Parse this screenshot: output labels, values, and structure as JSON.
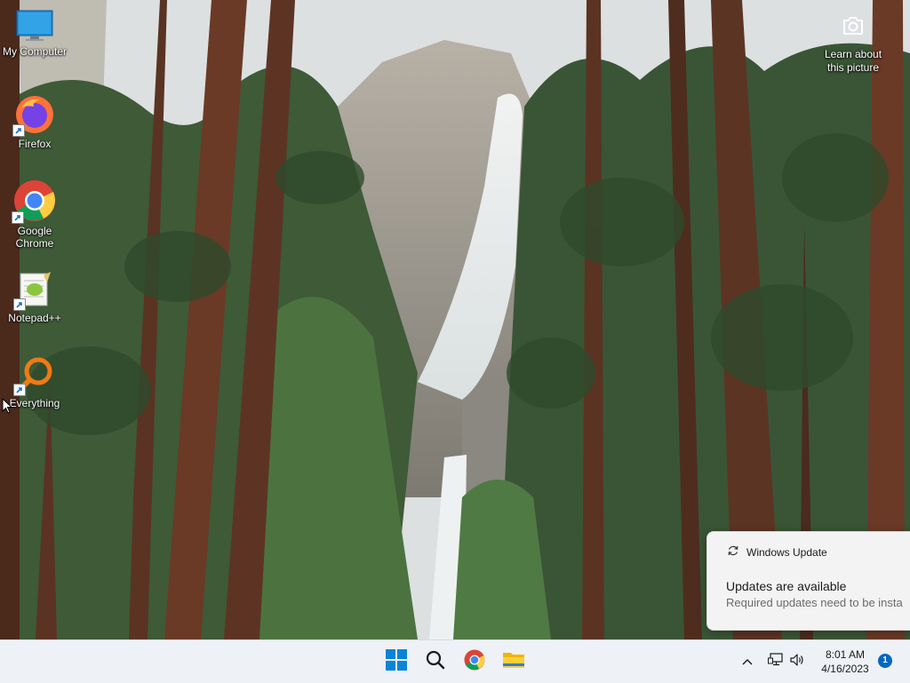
{
  "desktop": {
    "icons": [
      {
        "label": "My Computer",
        "icon": "monitor-icon"
      },
      {
        "label": "Firefox",
        "icon": "firefox-icon"
      },
      {
        "label": "Google Chrome",
        "icon": "chrome-icon"
      },
      {
        "label": "Notepad++",
        "icon": "notepad-plus-plus-icon"
      },
      {
        "label": "Everything",
        "icon": "everything-search-icon"
      }
    ],
    "learn_about_picture": {
      "line1": "Learn about",
      "line2": "this picture",
      "icon": "camera-icon"
    }
  },
  "toast": {
    "app": "Windows Update",
    "app_icon": "sync-icon",
    "title": "Updates are available",
    "body": "Required updates need to be insta"
  },
  "taskbar": {
    "pinned": [
      {
        "name": "start",
        "icon": "windows-logo-icon"
      },
      {
        "name": "search",
        "icon": "search-icon"
      },
      {
        "name": "chrome",
        "icon": "chrome-icon"
      },
      {
        "name": "file-explorer",
        "icon": "folder-icon"
      }
    ],
    "tray": {
      "overflow_icon": "chevron-up-icon",
      "network_icon": "network-icon",
      "volume_icon": "speaker-icon"
    },
    "clock": {
      "time": "8:01 AM",
      "date": "4/16/2023"
    },
    "notification_count": "1"
  },
  "colors": {
    "accent": "#0067c0",
    "taskbar_bg": "#eef1f5",
    "toast_bg": "#f3f3f3"
  }
}
